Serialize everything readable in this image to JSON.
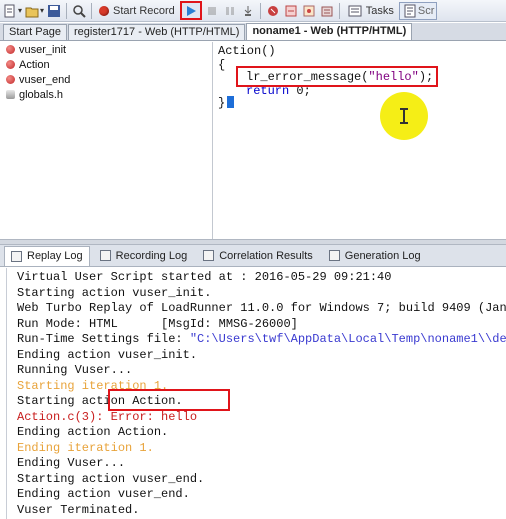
{
  "toolbar": {
    "start_record_label": "Start Record",
    "tasks_label": "Tasks",
    "script_label": "Scr"
  },
  "tabs": [
    {
      "label": "Start Page"
    },
    {
      "label": "register1717 - Web (HTTP/HTML)"
    },
    {
      "label": "noname1 - Web (HTTP/HTML)"
    }
  ],
  "tree": {
    "items": [
      {
        "label": "vuser_init"
      },
      {
        "label": "Action"
      },
      {
        "label": "vuser_end"
      },
      {
        "label": "globals.h"
      }
    ]
  },
  "editor": {
    "line1": "Action()",
    "line2": "{",
    "line3_fn": "lr_error_message(",
    "line3_str": "\"hello\"",
    "line3_end": ");",
    "line4_kw": "return",
    "line4_rest": " 0;",
    "line5": "}"
  },
  "logtabs": [
    {
      "label": "Replay Log"
    },
    {
      "label": "Recording Log"
    },
    {
      "label": "Correlation Results"
    },
    {
      "label": "Generation Log"
    }
  ],
  "log": {
    "lines": [
      "Virtual User Script started at : 2016-05-29 09:21:40",
      "Starting action vuser_init.",
      "Web Turbo Replay of LoadRunner 11.0.0 for Windows 7; build 9409 (Jan",
      "Run Mode: HTML      [MsgId: MMSG-26000]",
      "Ending action vuser_init.",
      "Running Vuser...",
      "Starting iteration 1.",
      "Starting action Action.",
      "Action.c(3): Error: hello",
      "Ending action Action.",
      "Ending iteration 1.",
      "Ending Vuser...",
      "Starting action vuser_end.",
      "Ending action vuser_end.",
      "Vuser Terminated."
    ],
    "runtime_label": "Run-Time Settings file: ",
    "runtime_path": "\"C:\\Users\\twf\\AppData\\Local\\Temp\\noname1\\\\de"
  }
}
